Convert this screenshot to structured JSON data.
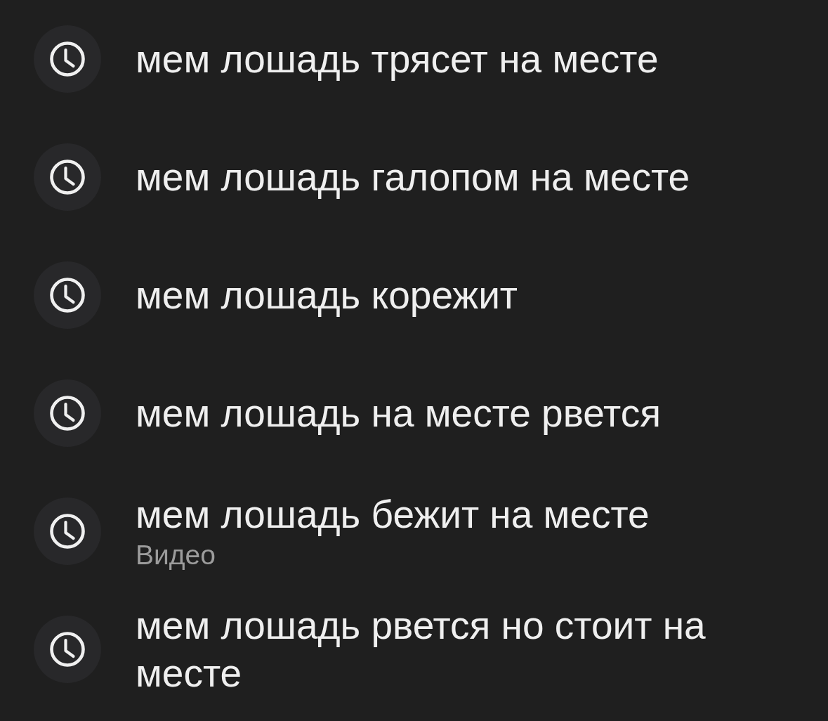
{
  "suggestions": [
    {
      "text": "мем лошадь трясет на месте"
    },
    {
      "text": "мем лошадь галопом на месте"
    },
    {
      "text": "мем лошадь корежит"
    },
    {
      "text": "мем лошадь на месте рвется"
    },
    {
      "text": "мем лошадь бежит на месте",
      "subtitle": "Видео"
    },
    {
      "text": "мем лошадь рвется но стоит на месте"
    }
  ]
}
